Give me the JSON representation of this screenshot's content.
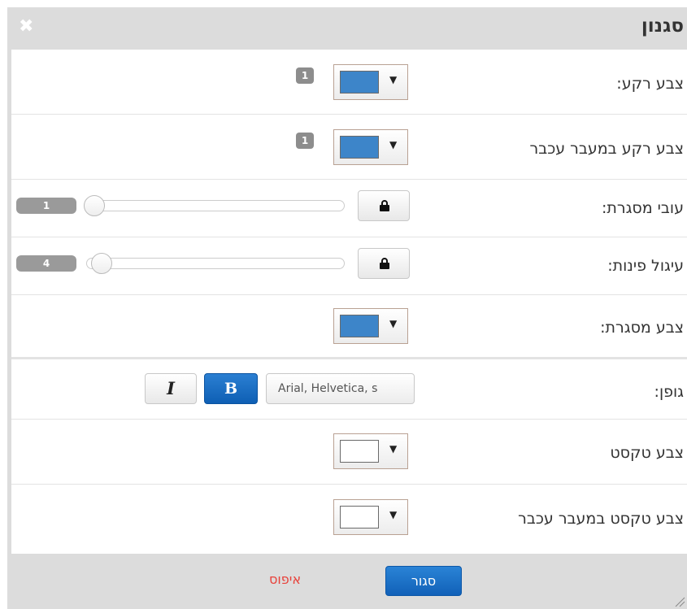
{
  "dialog": {
    "title": "סגנון",
    "close_icon": "close-icon",
    "close_glyph": "✖"
  },
  "rows": {
    "background_color": {
      "label": "צבע רקע:",
      "swatch_color": "#3d85c9",
      "badge": "1"
    },
    "hover_background_color": {
      "label": "צבע רקע במעבר עכבר",
      "swatch_color": "#3d85c9",
      "badge": "1"
    },
    "border_width": {
      "label": "עובי מסגרת:",
      "value": "1",
      "slider_fraction": 0.0
    },
    "corner_radius": {
      "label": "עיגול פינות:",
      "value": "4",
      "slider_fraction": 0.03
    },
    "border_color": {
      "label": "צבע מסגרת:",
      "swatch_color": "#3d85c9"
    },
    "font": {
      "label": "גופן:",
      "font_value": "Arial, Helvetica, s",
      "bold_label": "B",
      "italic_label": "I"
    },
    "text_color": {
      "label": "צבע טקסט",
      "swatch_color": "#ffffff"
    },
    "hover_text_color": {
      "label": "צבע טקסט במעבר עכבר",
      "swatch_color": "#ffffff"
    }
  },
  "dropdown_arrow": "▼",
  "footer": {
    "close_label": "סגור",
    "reset_label": "איפוס"
  },
  "colors": {
    "accent": "#1a6fc4",
    "reset_red": "#e8413a",
    "chrome": "#dcdcdc"
  }
}
